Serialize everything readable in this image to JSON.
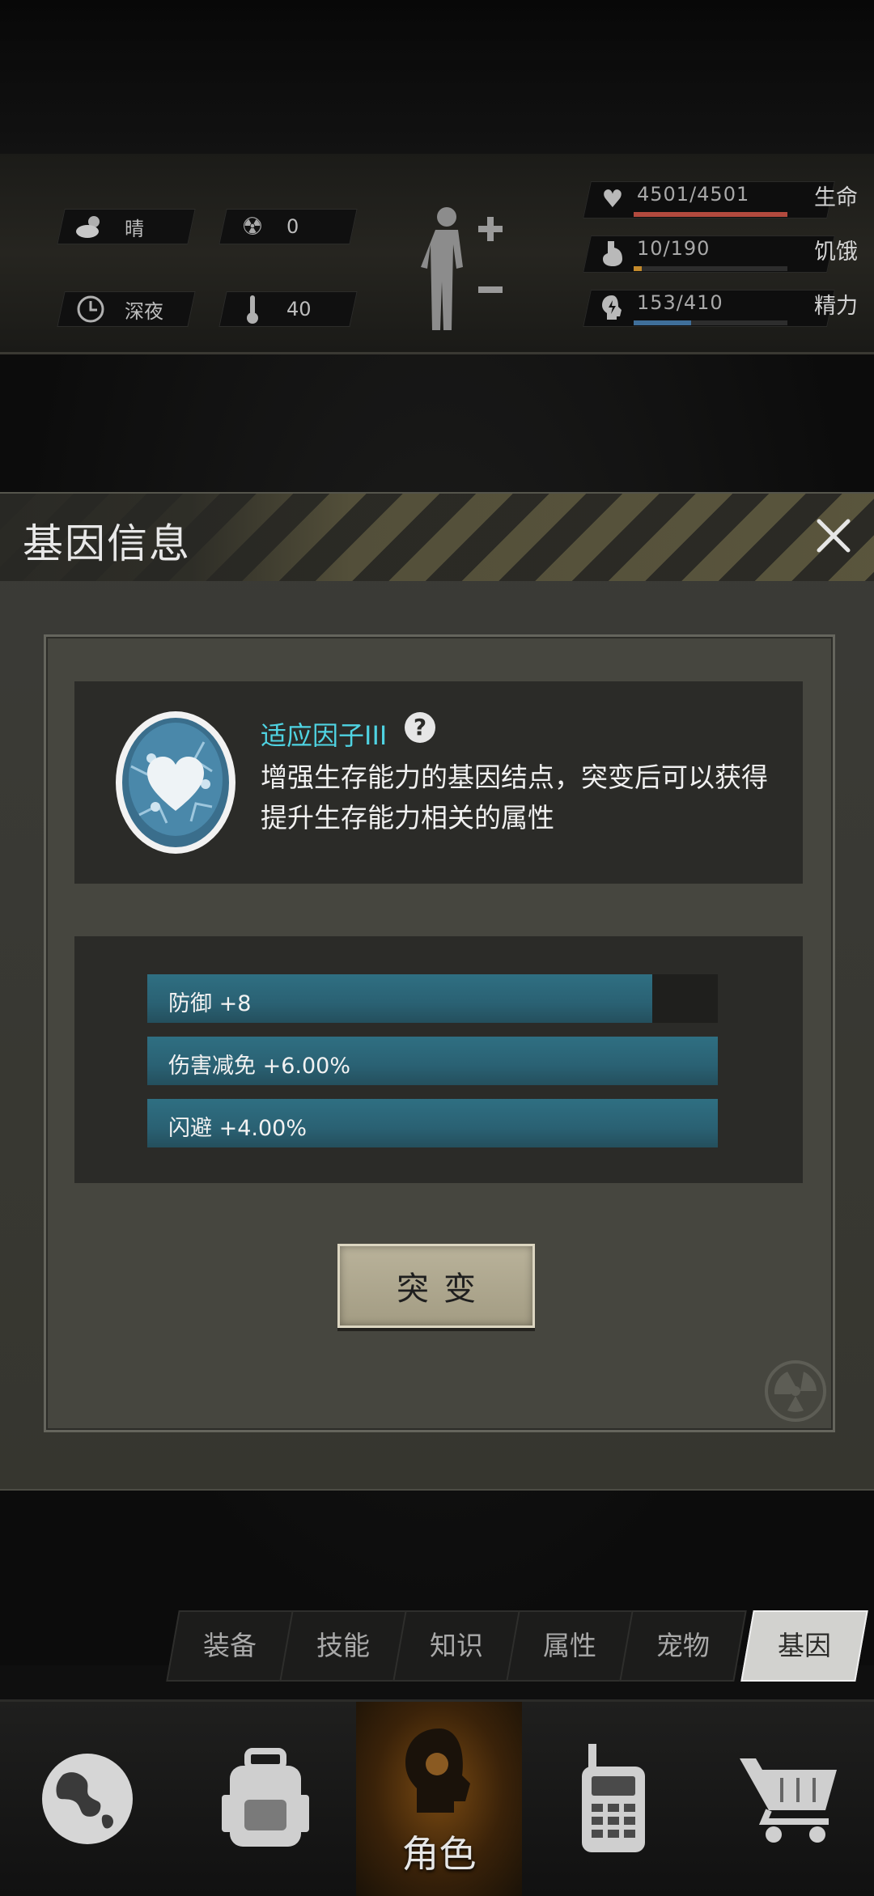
{
  "status": {
    "weather": {
      "icon": "cloud-sun-icon",
      "label": "晴"
    },
    "radiation": {
      "icon": "radiation-icon",
      "value": "0"
    },
    "time": {
      "icon": "clock-icon",
      "label": "深夜"
    },
    "temperature": {
      "icon": "thermometer-icon",
      "value": "40"
    },
    "stats": [
      {
        "key": "life",
        "icon": "heart-icon",
        "value": "4501/4501",
        "label": "生命",
        "fraction": 1.0,
        "color": "#b24a3e"
      },
      {
        "key": "hunger",
        "icon": "stomach-icon",
        "value": "10/190",
        "label": "饥饿",
        "fraction": 0.053,
        "color": "#c48a2b"
      },
      {
        "key": "energy",
        "icon": "energy-icon",
        "value": "153/410",
        "label": "精力",
        "fraction": 0.373,
        "color": "#3f6f9a"
      }
    ]
  },
  "dialog": {
    "title": "基因信息",
    "gene": {
      "name": "适应因子III",
      "help": "?",
      "description": "增强生存能力的基因结点，突变后可以获得提升生存能力相关的属性"
    },
    "attributes": [
      {
        "text": "防御 +8",
        "fill": 0.885
      },
      {
        "text": "伤害减免 +6.00%",
        "fill": 1.0
      },
      {
        "text": "闪避 +4.00%",
        "fill": 1.0
      }
    ],
    "mutate_label": "突变"
  },
  "tabs": [
    "装备",
    "技能",
    "知识",
    "属性",
    "宠物",
    "基因"
  ],
  "active_tab": "基因",
  "nav": [
    {
      "icon": "globe-icon",
      "label": ""
    },
    {
      "icon": "backpack-icon",
      "label": ""
    },
    {
      "icon": "character-head-icon",
      "label": "角色"
    },
    {
      "icon": "walkie-talkie-icon",
      "label": ""
    },
    {
      "icon": "shopping-cart-icon",
      "label": ""
    }
  ]
}
